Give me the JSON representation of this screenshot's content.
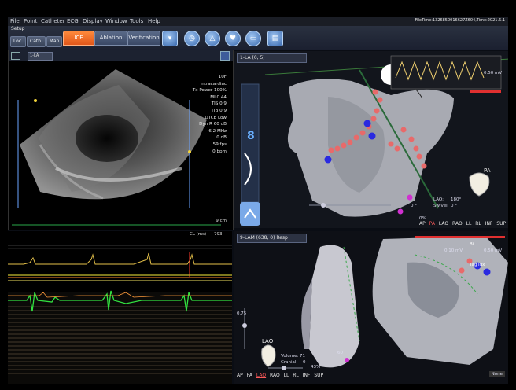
{
  "menu": {
    "items": [
      "File",
      "Point",
      "Catheter",
      "ECG",
      "Display",
      "Window",
      "Tools",
      "Help"
    ],
    "status": "FileTime:1326850016627Z604,Time:2021.6.1"
  },
  "toolbar": {
    "setup_label": "Setup",
    "buttons": [
      "Loc.",
      "Cath.",
      "Map"
    ],
    "tabs": [
      "ICE",
      "Ablation",
      "Verification"
    ],
    "active_tab": "ICE"
  },
  "ice": {
    "selector": "1-LA",
    "info": [
      "10F",
      "Intracardiac",
      "Tx Power 100%",
      "MI 0.44",
      "TIS 0.9",
      "TIB 0.9",
      "DTCE Low",
      "Dyn R 60 dB",
      "6.2 MHz",
      "0 dB",
      "59 fps",
      "0 bpm"
    ],
    "depth_label": "9 cm",
    "cl_label": "CL (ms)",
    "cl_value": "793"
  },
  "map_top": {
    "title": "1-LA (0, 5)",
    "voltage_label": "0.50 mV",
    "lao_label": "LAO:",
    "lao_value": "180°",
    "swivel_label": "Swivel:",
    "swivel_value": "0 °",
    "cranial_value": "0 °",
    "pa_label": "PA",
    "opacity_value": "0%",
    "views": [
      "AP",
      "PA",
      "LAO",
      "RAO",
      "LL",
      "RL",
      "INF",
      "SUP"
    ],
    "active_view": "PA",
    "side_number": "8"
  },
  "map_bottom": {
    "title": "9-LAM (638, 0) Resp",
    "bi_label": "Bi",
    "bi_min": "0.10 mV",
    "bi_max": "0.50 mV",
    "tag_label": "Tag Idx",
    "lao_label": "LAO",
    "volume_label": "Volume: 71",
    "cranial_label": "Cranial:",
    "cranial_value": "0",
    "value_60": "60",
    "value_075": "0.75",
    "opacity_value": "43%",
    "views": [
      "AP",
      "PA",
      "LAO",
      "RAO",
      "LL",
      "RL",
      "INF",
      "SUP"
    ],
    "active_view": "LAO",
    "none_label": "None"
  }
}
